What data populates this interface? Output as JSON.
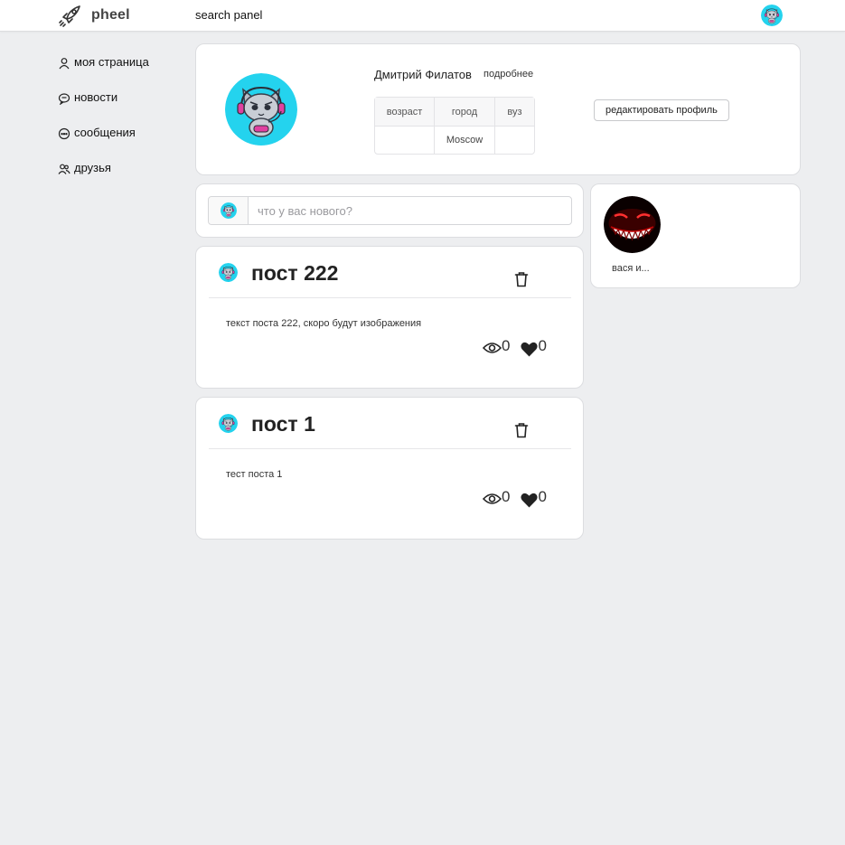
{
  "header": {
    "app_name": "pheel",
    "search_label": "search panel"
  },
  "sidebar": {
    "items": [
      {
        "label": "моя страница",
        "icon": "user-icon"
      },
      {
        "label": "новости",
        "icon": "news-icon"
      },
      {
        "label": "сообщения",
        "icon": "message-icon"
      },
      {
        "label": "друзья",
        "icon": "friends-icon"
      }
    ]
  },
  "profile": {
    "name": "Дмитрий Филатов",
    "more_link": "подробнее",
    "table": {
      "headers": [
        "возраст",
        "город",
        "вуз"
      ],
      "values": [
        "",
        "Moscow",
        ""
      ]
    },
    "edit_button": "редактировать профиль"
  },
  "composer": {
    "placeholder": "что у вас нового?"
  },
  "friends": [
    {
      "name": "вася и..."
    }
  ],
  "posts": [
    {
      "title": "пост 222",
      "text": "текст поста 222, скоро будут изображения",
      "views": "0",
      "likes": "0"
    },
    {
      "title": "пост 1",
      "text": "тест поста 1",
      "views": "0",
      "likes": "0"
    }
  ],
  "colors": {
    "accent": "#2ad4ec",
    "background": "#edeef0",
    "card": "#ffffff"
  }
}
